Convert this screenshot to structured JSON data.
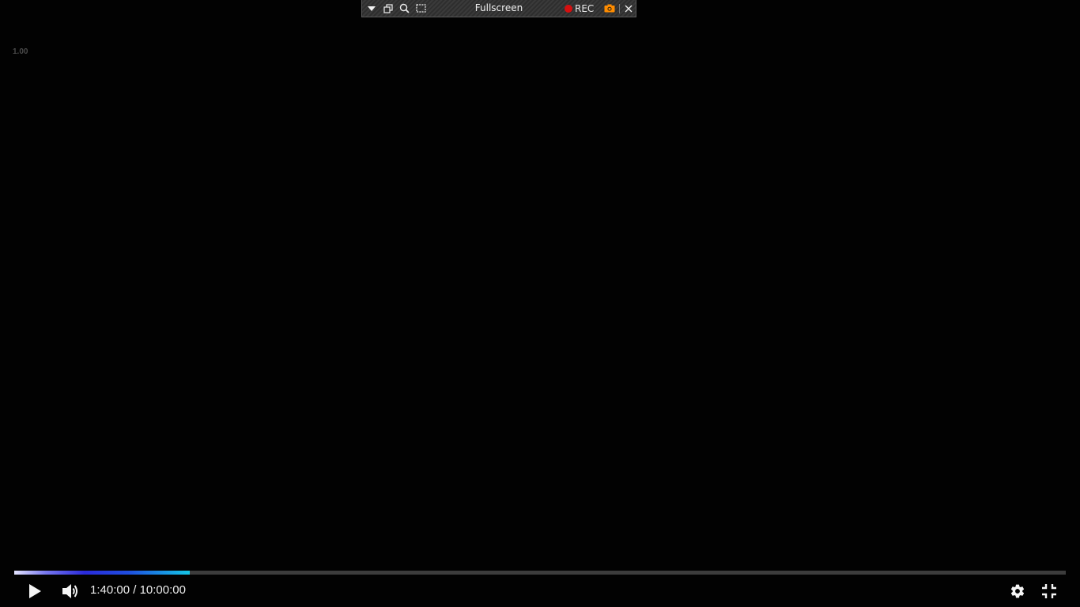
{
  "capture_toolbar": {
    "title": "Fullscreen",
    "rec_label": "REC",
    "icons": [
      "dropdown-arrow-icon",
      "restore-window-icon",
      "zoom-icon",
      "region-select-icon",
      "record-dot-icon",
      "camera-icon",
      "close-icon"
    ],
    "rec_color": "#d60f0f",
    "camera_color": "#ff8c00"
  },
  "overlay": {
    "speed": "1.00"
  },
  "player": {
    "current_time": "1:40:00",
    "separator": " / ",
    "duration": "10:00:00",
    "progress_fraction": 0.1667,
    "icons": [
      "play-icon",
      "volume-icon",
      "settings-gear-icon",
      "exit-fullscreen-icon"
    ]
  }
}
